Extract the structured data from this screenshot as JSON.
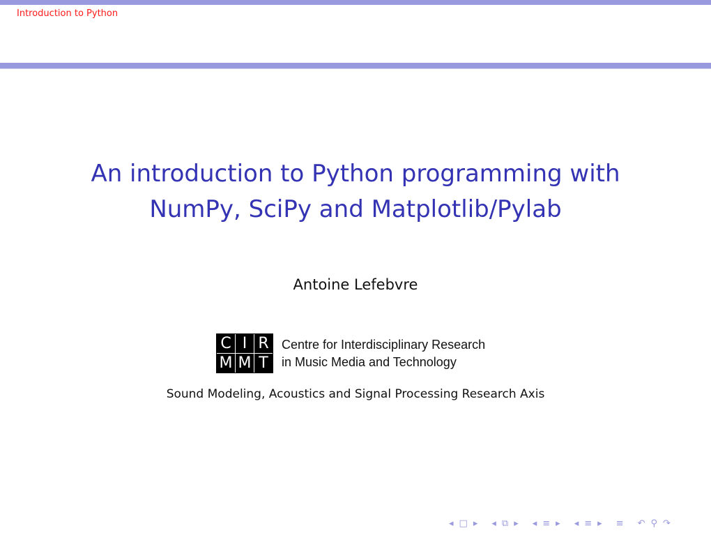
{
  "header": {
    "section_title": "Introduction to Python"
  },
  "slide": {
    "title_line1": "An introduction to Python programming with",
    "title_line2": "NumPy, SciPy and Matplotlib/Pylab",
    "author": "Antoine Lefebvre",
    "logo": {
      "cells": [
        "C",
        "I",
        "R",
        "M",
        "M",
        "T"
      ],
      "text_line1": "Centre for Interdisciplinary Research",
      "text_line2": "in Music Media and Technology"
    },
    "institute": "Sound Modeling, Acoustics and Signal Processing Research Axis"
  },
  "colors": {
    "bar": "#9999dd",
    "title": "#3333b3",
    "header": "#ff1a1a"
  },
  "nav": {
    "icons": [
      "◂",
      "□",
      "▸",
      "◂",
      "⧉",
      "▸",
      "◂",
      "≡",
      "▸",
      "◂",
      "≡",
      "▸",
      "≡",
      "↶",
      "⚲",
      "↷"
    ]
  }
}
